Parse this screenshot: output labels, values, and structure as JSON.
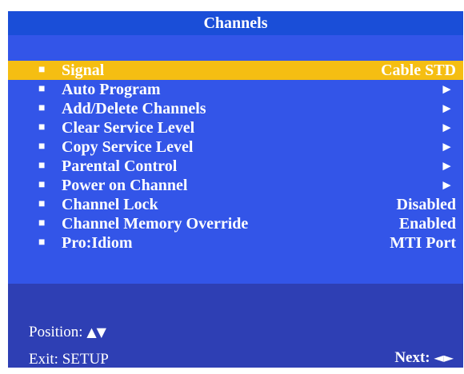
{
  "title": "Channels",
  "menu": {
    "items": [
      {
        "bullet": "■",
        "label": "Signal",
        "value": "Cable STD"
      },
      {
        "bullet": "■",
        "label": "Auto Program",
        "value": "►"
      },
      {
        "bullet": "■",
        "label": "Add/Delete Channels",
        "value": "►"
      },
      {
        "bullet": "■",
        "label": "Clear Service Level",
        "value": "►"
      },
      {
        "bullet": "■",
        "label": "Copy Service Level",
        "value": "►"
      },
      {
        "bullet": "■",
        "label": "Parental Control",
        "value": "►"
      },
      {
        "bullet": "■",
        "label": "Power on Channel",
        "value": "►"
      },
      {
        "bullet": "■",
        "label": "Channel Lock",
        "value": "Disabled"
      },
      {
        "bullet": "■",
        "label": "Channel Memory Override",
        "value": "Enabled"
      },
      {
        "bullet": "■",
        "label": "Pro:Idiom",
        "value": "MTI Port"
      }
    ],
    "selected_label": "Signal"
  },
  "footer": {
    "position_label": "Position:",
    "position_glyphs": "▲▼",
    "exit_label": "Exit: SETUP",
    "next_label": "Next:",
    "next_glyphs": "◄►"
  },
  "colors": {
    "panel": "#3355e8",
    "title_bar": "#1a4ed8",
    "selected": "#f5be12",
    "footer": "#2e3fb4",
    "text": "#ffffff"
  },
  "icons": {
    "bullet": "square-bullet-icon",
    "submenu": "right-arrow-icon",
    "position": "up-down-arrows-icon",
    "next": "left-right-arrows-icon"
  }
}
